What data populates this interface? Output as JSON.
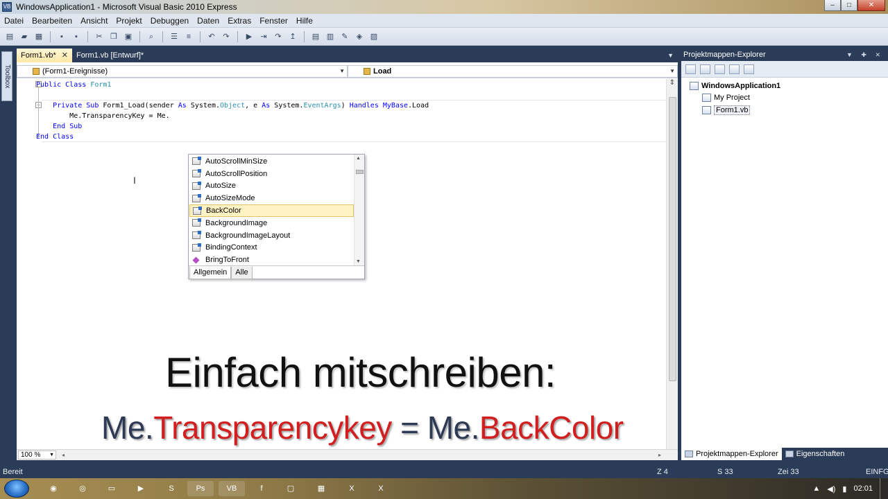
{
  "window": {
    "title": "WindowsApplication1 - Microsoft Visual Basic 2010 Express",
    "controls": [
      "–",
      "□",
      "✕"
    ]
  },
  "menu": [
    "Datei",
    "Bearbeiten",
    "Ansicht",
    "Projekt",
    "Debuggen",
    "Daten",
    "Extras",
    "Fenster",
    "Hilfe"
  ],
  "toolbox": {
    "label": "Toolbox"
  },
  "doc_tabs": {
    "active": "Form1.vb*",
    "inactive": "Form1.vb [Entwurf]*",
    "close": "✕"
  },
  "navbar": {
    "left": "(Form1-Ereignisse)",
    "right": "Load"
  },
  "code": {
    "line1_a": "Public",
    "line1_b": "Class",
    "line1_c": "Form1",
    "line2_a": "Private",
    "line2_b": "Sub",
    "line2_c": "Form1_Load(sender",
    "line2_d": "As",
    "line2_e": "System.",
    "line2_f": "Object",
    "line2_g": ", e",
    "line2_h": "As",
    "line2_i": "System.",
    "line2_j": "EventArgs",
    "line2_k": ")",
    "line2_l": "Handles",
    "line2_m": "MyBase",
    "line2_n": ".Load",
    "line3": "Me.TransparencyKey = Me.",
    "line4_a": "End",
    "line4_b": "Sub",
    "line5_a": "End",
    "line5_b": "Class"
  },
  "intellisense": {
    "items": [
      {
        "label": "AutoScrollMinSize",
        "kind": "property"
      },
      {
        "label": "AutoScrollPosition",
        "kind": "property"
      },
      {
        "label": "AutoSize",
        "kind": "property"
      },
      {
        "label": "AutoSizeMode",
        "kind": "property"
      },
      {
        "label": "BackColor",
        "kind": "property",
        "selected": true
      },
      {
        "label": "BackgroundImage",
        "kind": "property"
      },
      {
        "label": "BackgroundImageLayout",
        "kind": "property"
      },
      {
        "label": "BindingContext",
        "kind": "property"
      },
      {
        "label": "BringToFront",
        "kind": "method"
      }
    ],
    "tab_common": "Allgemein",
    "tab_all": "Alle"
  },
  "zoom": "100 %",
  "overlay": {
    "line1": "Einfach mitschreiben:",
    "line2_a": "Me.",
    "line2_b": "Transparencykey",
    "line2_c": " = Me.",
    "line2_d": "BackColor",
    "colors": {
      "dark": "#2e3a55",
      "red": "#d11f1f"
    }
  },
  "solution_explorer": {
    "title": "Projektmappen-Explorer",
    "root": "WindowsApplication1",
    "items": [
      "My Project",
      "Form1.vb"
    ],
    "tab_explorer": "Projektmappen-Explorer",
    "tab_properties": "Eigenschaften"
  },
  "status": {
    "text": "Bereit",
    "row": "Z 4",
    "col": "S 33",
    "char": "Zei 33",
    "mode": "EINFG"
  },
  "taskbar": {
    "clock": "02:01"
  }
}
